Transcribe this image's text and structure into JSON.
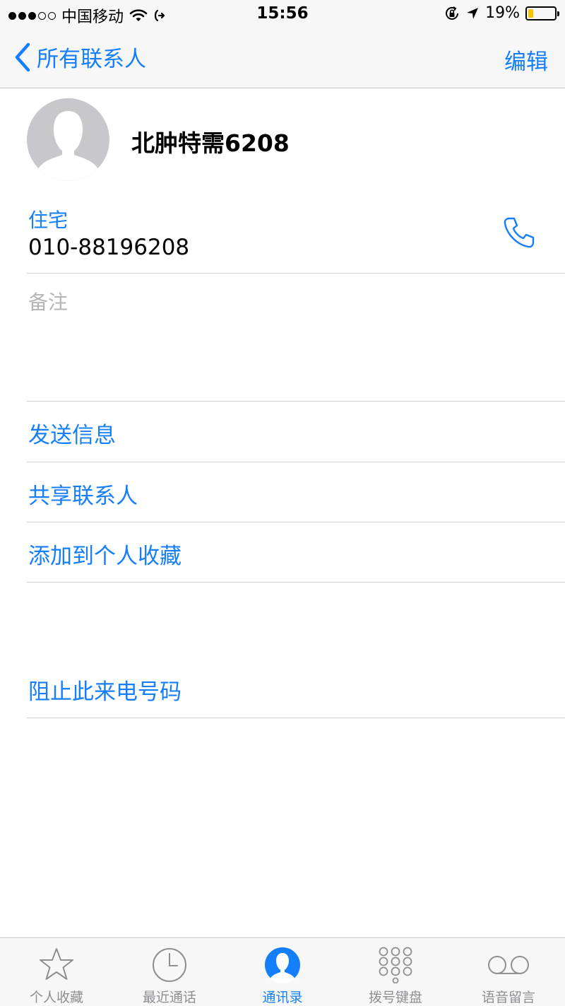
{
  "status_bar": {
    "carrier": "中国移动",
    "time": "15:56",
    "battery_percent": "19%",
    "battery_level": 0.19,
    "signal_bars": 3,
    "signal_total": 5
  },
  "nav": {
    "back_label": "所有联系人",
    "edit_label": "编辑"
  },
  "contact": {
    "name": "北肿特需6208",
    "phone_label": "住宅",
    "phone_number": "010-88196208",
    "notes_label": "备注"
  },
  "actions": {
    "send_message": "发送信息",
    "share_contact": "共享联系人",
    "add_favorite": "添加到个人收藏",
    "block_caller": "阻止此来电号码"
  },
  "tabs": [
    {
      "label": "个人收藏",
      "icon": "star-icon"
    },
    {
      "label": "最近通话",
      "icon": "clock-icon"
    },
    {
      "label": "通讯录",
      "icon": "contacts-icon",
      "active": true
    },
    {
      "label": "拨号键盘",
      "icon": "keypad-icon"
    },
    {
      "label": "语音留言",
      "icon": "voicemail-icon"
    }
  ],
  "colors": {
    "accent": "#157efb",
    "inactive": "#8e8e93",
    "battery": "#f7c600"
  }
}
